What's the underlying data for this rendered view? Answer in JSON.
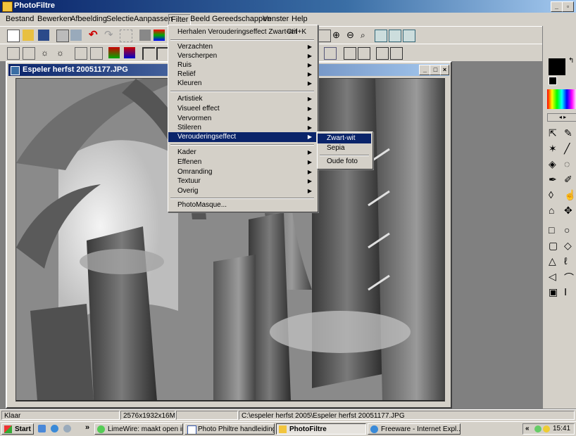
{
  "app": {
    "title": "PhotoFiltre"
  },
  "menubar": [
    "Bestand",
    "Bewerken",
    "Afbeelding",
    "Selectie",
    "Aanpassen",
    "Filter",
    "Beeld",
    "Gereedschappen",
    "Venster",
    "Help"
  ],
  "document": {
    "title": "Espeler herfst 20051177.JPG"
  },
  "filter_menu": {
    "repeat_label": "Herhalen Verouderingseffect Zwart-wit",
    "repeat_shortcut": "Ctrl+K",
    "group1": [
      "Verzachten",
      "Verscherpen",
      "Ruis",
      "Reliëf",
      "Kleuren"
    ],
    "group2": [
      "Artistiek",
      "Visueel effect",
      "Vervormen",
      "Stileren",
      "Verouderingseffect"
    ],
    "group3": [
      "Kader",
      "Effenen",
      "Omranding",
      "Textuur",
      "Overig"
    ],
    "photomasque": "PhotoMasque..."
  },
  "submenu": {
    "items": [
      "Zwart-wit",
      "Sepia",
      "Oude foto"
    ]
  },
  "status": {
    "state": "Klaar",
    "size": "2576x1932x16M",
    "path": "C:\\espeler herfst 2005\\Espeler herfst 20051177.JPG"
  },
  "taskbar": {
    "start": "Start",
    "chevron": "»",
    "tasks": [
      "LimeWire: maakt open in...",
      "Photo Philtre handleiding...",
      "PhotoFiltre",
      "Freeware - Internet Expl..."
    ],
    "clock": "15:41",
    "tray_chevron": "«"
  },
  "colors": {
    "titlebar": "#0a246a",
    "highlight": "#0a246a",
    "face": "#d4d0c8"
  }
}
